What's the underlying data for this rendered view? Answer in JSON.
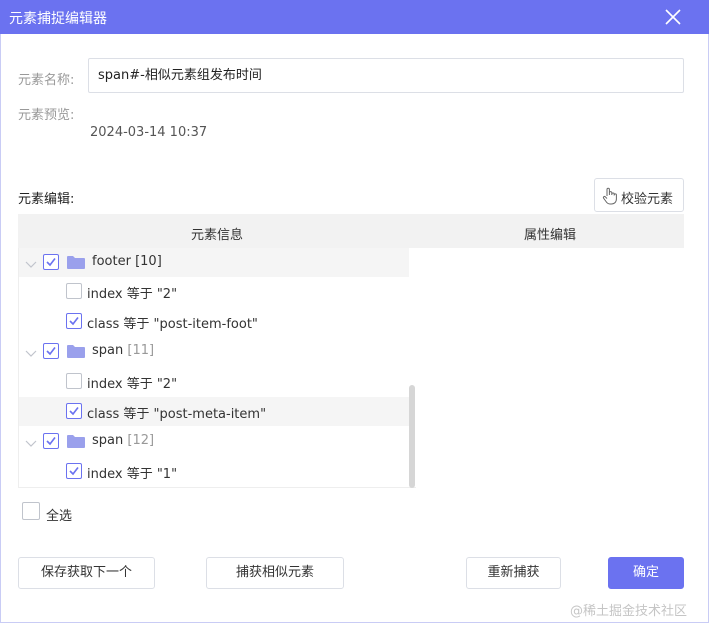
{
  "window": {
    "title": "元素捕捉编辑器"
  },
  "element_name": {
    "label": "元素名称:",
    "value": "span#-相似元素组发布时间"
  },
  "element_preview": {
    "label": "元素预览:",
    "value": "2024-03-14 10:37"
  },
  "element_edit": {
    "label": "元素编辑:",
    "verify_label": "校验元素"
  },
  "table": {
    "col_info": "元素信息",
    "col_attr": "属性编辑"
  },
  "tree": {
    "node_footer": {
      "name": "footer",
      "count": "[10]",
      "checked": true
    },
    "footer_index": {
      "text": "index 等于 \"2\"",
      "checked": false
    },
    "footer_class": {
      "text": "class 等于 \"post-item-foot\"",
      "checked": true
    },
    "node_span_11": {
      "name": "span",
      "count": "[11]",
      "checked": true
    },
    "span11_index": {
      "text": "index 等于 \"2\"",
      "checked": false
    },
    "span11_class": {
      "text": "class 等于 \"post-meta-item\"",
      "checked": true
    },
    "node_span_12": {
      "name": "span",
      "count": "[12]",
      "checked": true
    },
    "span12_index": {
      "text": "index 等于 \"1\"",
      "checked": true
    }
  },
  "select_all": {
    "label": "全选",
    "checked": false
  },
  "buttons": {
    "save_next": "保存获取下一个",
    "capture_similar": "捕获相似元素",
    "recapture": "重新捕获",
    "confirm": "确定"
  },
  "watermark": "@稀土掘金技术社区",
  "colors": {
    "accent": "#6b72f0",
    "folder": "#9aa0ec"
  }
}
